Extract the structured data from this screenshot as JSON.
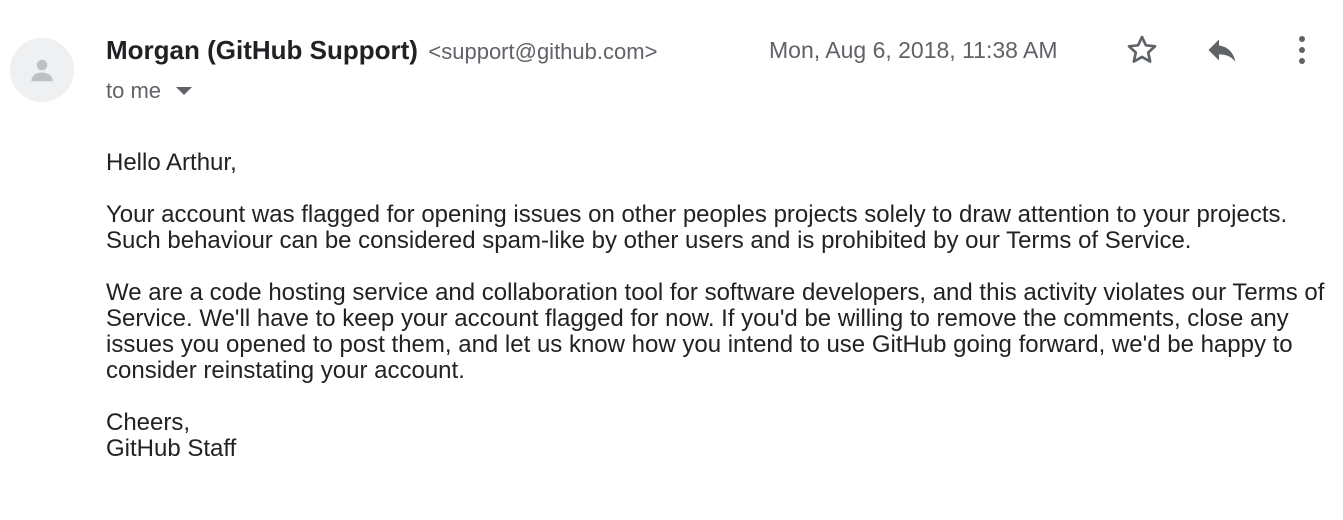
{
  "message": {
    "sender": {
      "name": "Morgan (GitHub Support)",
      "email": "<support@github.com>"
    },
    "date": "Mon, Aug 6, 2018, 11:38 AM",
    "recipient_label": "to me",
    "actions": {
      "star_icon": "star-outline-icon",
      "reply_icon": "reply-icon",
      "more_icon": "more-vertical-icon"
    },
    "body": {
      "greeting": "Hello Arthur,",
      "paragraph_1": "Your account was flagged for opening issues on other peoples projects solely to draw attention to your projects. Such behaviour can be considered spam-like by other users and is prohibited by our Terms of Service.",
      "paragraph_2": "We are a code hosting service and collaboration tool for software developers, and this activity violates our Terms of Service. We'll have to keep your account flagged for now. If you'd be willing to remove the comments, close any issues you opened to post them, and let us know how you intend to use GitHub going forward, we'd be happy to consider reinstating your account.",
      "signoff": "Cheers,",
      "signature": "GitHub Staff"
    }
  },
  "colors": {
    "text": "#222222",
    "muted": "#5f6368",
    "avatar_bg": "#eef0f1",
    "avatar_fg": "#bdc1c6"
  }
}
